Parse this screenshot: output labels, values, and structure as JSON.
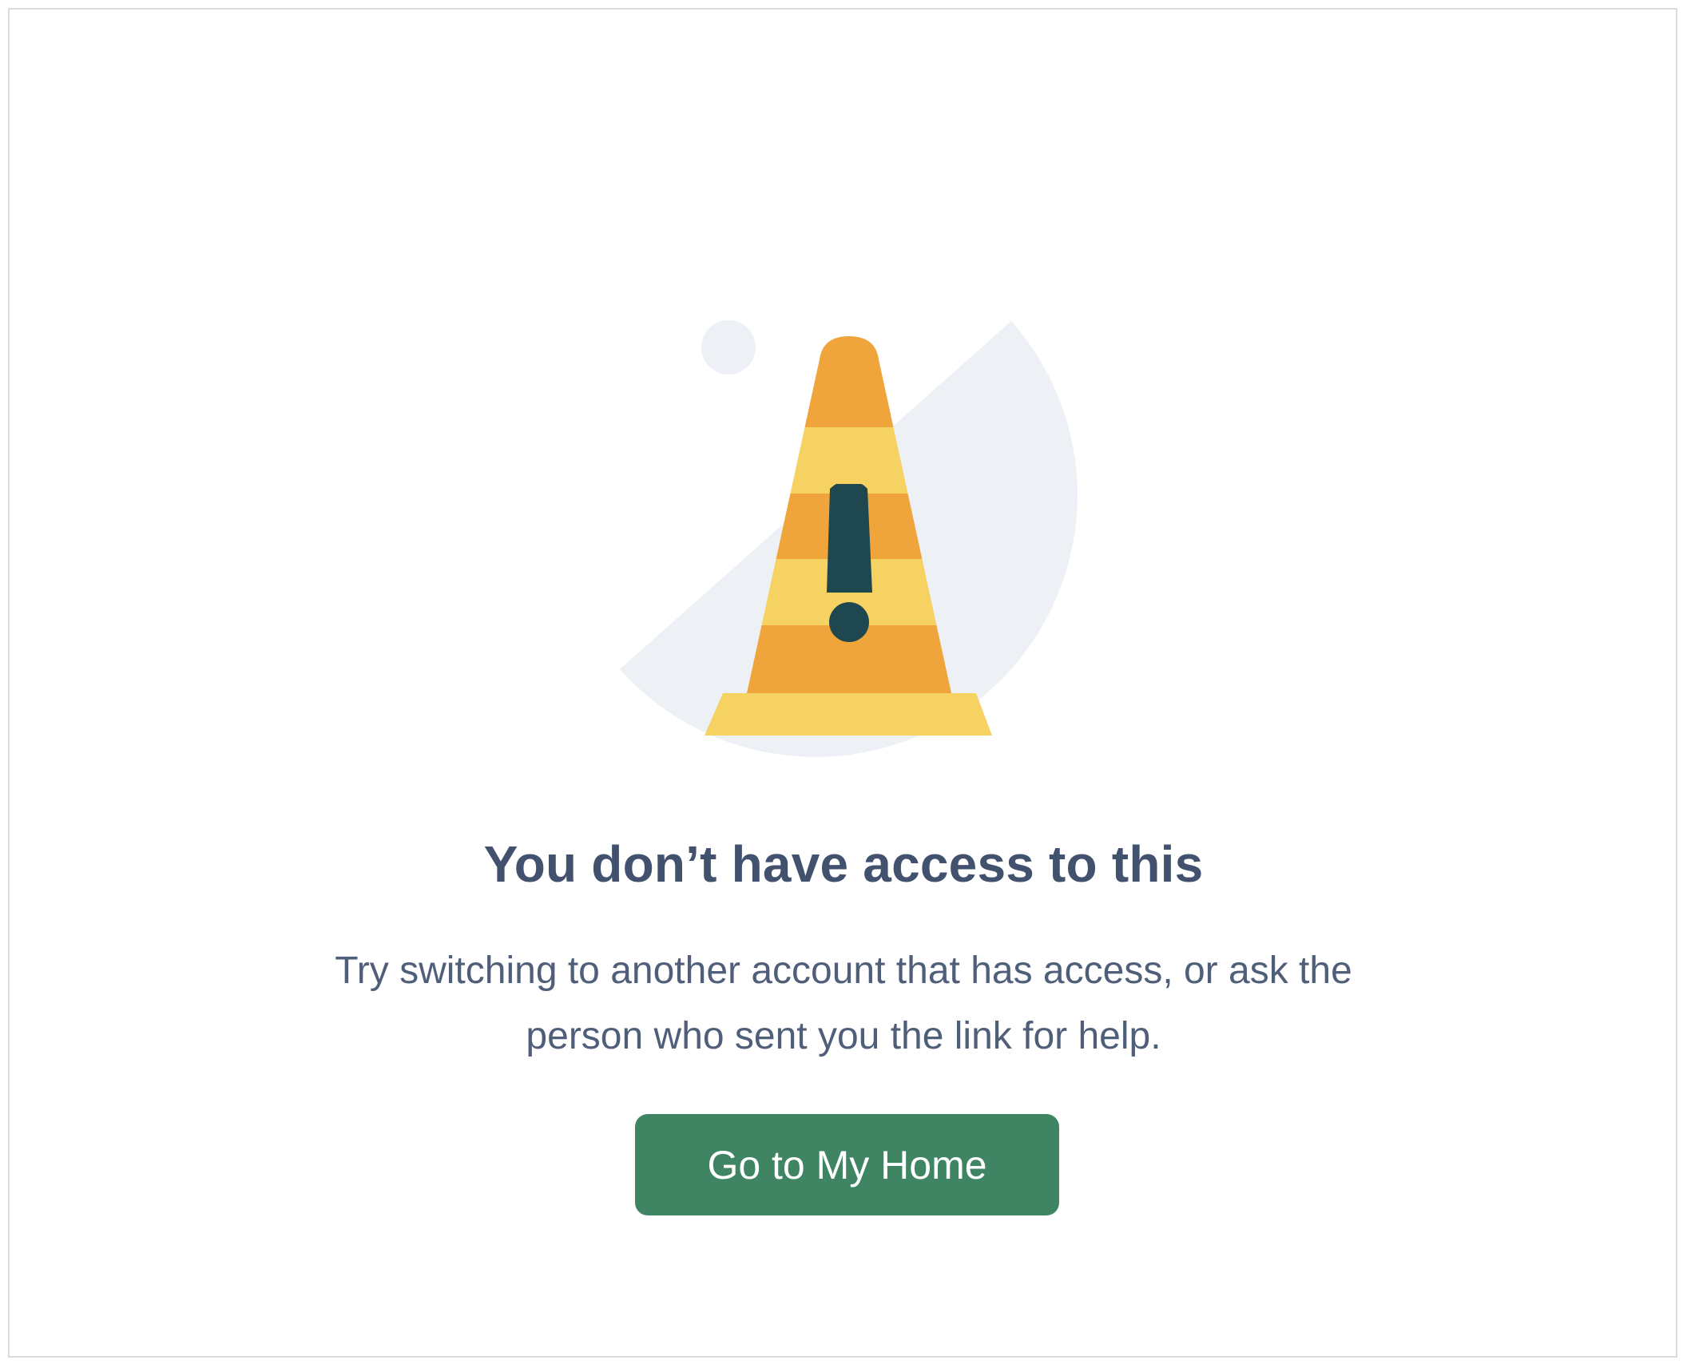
{
  "colors": {
    "accent": "#3f8564",
    "title": "#42526e",
    "text": "#505f79",
    "cone_dark": "#efa53b",
    "cone_light": "#f6d263",
    "exclamation": "#1f4750",
    "background_shape": "#edf0f5"
  },
  "icons": {
    "illustration": "traffic-cone-warning-icon"
  },
  "error": {
    "title": "You don’t have access to this",
    "message_line1": "Try switching to another account that has access, or ask the",
    "message_line2": "person who sent you the link for help."
  },
  "actions": {
    "home_label": "Go to My Home"
  }
}
